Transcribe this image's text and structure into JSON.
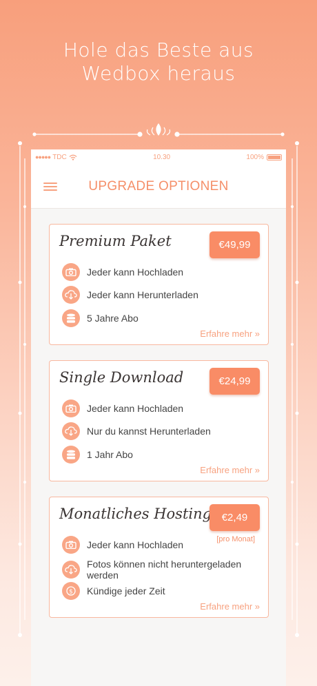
{
  "headline": {
    "line1": "Hole das Beste aus",
    "line2": "Wedbox heraus"
  },
  "status_bar": {
    "carrier": "TDC",
    "time": "10.30",
    "battery": "100%",
    "signal_dots": "●●●●●"
  },
  "nav": {
    "title": "UPGRADE OPTIONEN",
    "menu_icon": "hamburger-icon"
  },
  "colors": {
    "accent": "#f98c66",
    "accent_light": "#f9a686",
    "text": "#444444"
  },
  "cards": [
    {
      "title": "Premium Paket",
      "price": "€49,99",
      "price_note": "",
      "features": [
        {
          "icon": "camera-icon",
          "text": "Jeder kann Hochladen"
        },
        {
          "icon": "cloud-download-icon",
          "text": "Jeder kann Herunterladen"
        },
        {
          "icon": "database-icon",
          "text": "5 Jahre Abo"
        }
      ],
      "more": "Erfahre mehr »"
    },
    {
      "title": "Single Download",
      "price": "€24,99",
      "price_note": "",
      "features": [
        {
          "icon": "camera-icon",
          "text": "Jeder kann Hochladen"
        },
        {
          "icon": "cloud-download-icon",
          "text": "Nur du kannst Herunterladen"
        },
        {
          "icon": "database-icon",
          "text": "1 Jahr Abo"
        }
      ],
      "more": "Erfahre mehr »"
    },
    {
      "title": "Monatliches Hosting",
      "price": "€2,49",
      "price_note": "[pro Monat]",
      "features": [
        {
          "icon": "camera-icon",
          "text": "Jeder kann Hochladen"
        },
        {
          "icon": "cloud-download-icon",
          "text": "Fotos können nicht heruntergeladen werden"
        },
        {
          "icon": "dollar-icon",
          "text": "Kündige jeder Zeit"
        }
      ],
      "more": "Erfahre mehr »"
    }
  ]
}
